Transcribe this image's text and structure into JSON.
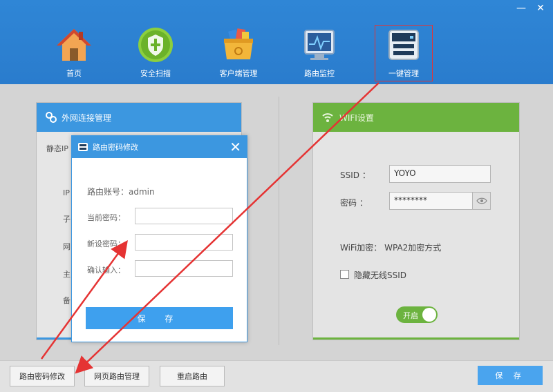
{
  "window": {
    "minimize": "—",
    "close": "✕"
  },
  "nav": {
    "items": [
      {
        "label": "首页",
        "icon": "home-icon"
      },
      {
        "label": "安全扫描",
        "icon": "shield-icon"
      },
      {
        "label": "客户端管理",
        "icon": "basket-icon"
      },
      {
        "label": "路由监控",
        "icon": "monitor-icon"
      },
      {
        "label": "一键管理",
        "icon": "router-icon"
      }
    ],
    "active_index": 4
  },
  "left_panel": {
    "title": "外网连接管理",
    "icon": "link-icon",
    "stubs": [
      "静态IP",
      "IP",
      "子",
      "网",
      "主",
      "备"
    ]
  },
  "wifi_panel": {
    "title": "WIFI设置",
    "icon": "wifi-icon",
    "ssid_label": "SSID ：",
    "ssid_value": "YOYO",
    "password_label": "密码 ：",
    "password_value": "********",
    "encryption": "WiFi加密： WPA2加密方式",
    "hide_ssid_label": "隐藏无线SSID",
    "hide_ssid_checked": false,
    "toggle_label": "开启",
    "toggle_on": true
  },
  "dialog": {
    "title": "路由密码修改",
    "account": "路由账号：admin",
    "current_password_label": "当前密码：",
    "new_password_label": "新设密码：",
    "confirm_label": "确认输入：",
    "save_label": "保 存"
  },
  "footer": {
    "buttons": [
      "路由密码修改",
      "网页路由管理",
      "重启路由"
    ],
    "save_label": "保 存"
  },
  "colors": {
    "header_blue": "#2f86d6",
    "accent_blue": "#3c97e0",
    "wifi_green": "#6cb33f",
    "annotation_red": "#e53333"
  }
}
